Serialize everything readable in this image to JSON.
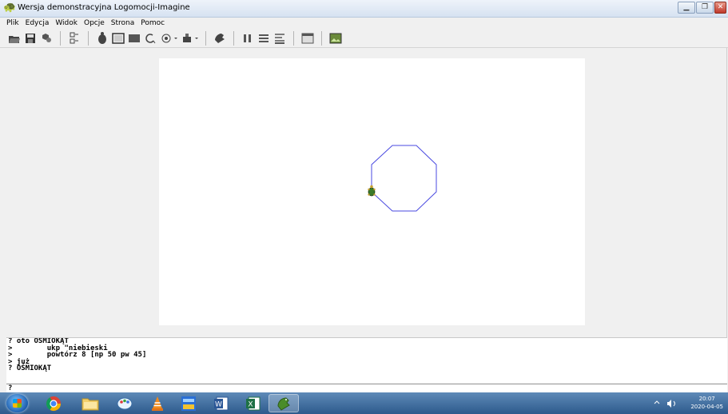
{
  "window": {
    "title": "Wersja demonstracyjna Logomocji-Imagine",
    "buttons": [
      "minimize",
      "maximize",
      "close"
    ]
  },
  "menu": [
    "Plik",
    "Edycja",
    "Widok",
    "Opcje",
    "Strona",
    "Pomoc"
  ],
  "toolbar": {
    "icons": [
      "open-icon",
      "save-icon",
      "print-icon",
      "pages-icon",
      "turtle-tool-icon",
      "rectangle-icon",
      "filled-rectangle-icon",
      "lasso-icon",
      "pen-icon",
      "paint-icon",
      "turtle-icon",
      "bars-icon",
      "lines-icon",
      "text-icon",
      "window-icon",
      "image-icon"
    ]
  },
  "canvas": {
    "shape": "octagon",
    "pen_color": "#4a4ae0",
    "background": "#ffffff"
  },
  "commands": {
    "lines": [
      "? oto OŚMIOKĄT",
      ">        ukp \"niebieski",
      ">        powtórz 8 [np 50 pw 45]",
      "> już",
      "? OŚMIOKĄT"
    ],
    "prompt": "?"
  },
  "taskbar": {
    "apps": [
      "windows-start",
      "chrome",
      "file-explorer",
      "paint-app",
      "vlc",
      "media-app",
      "word",
      "excel",
      "logomocja"
    ],
    "time": "20:07",
    "date": "2020-04-05"
  }
}
